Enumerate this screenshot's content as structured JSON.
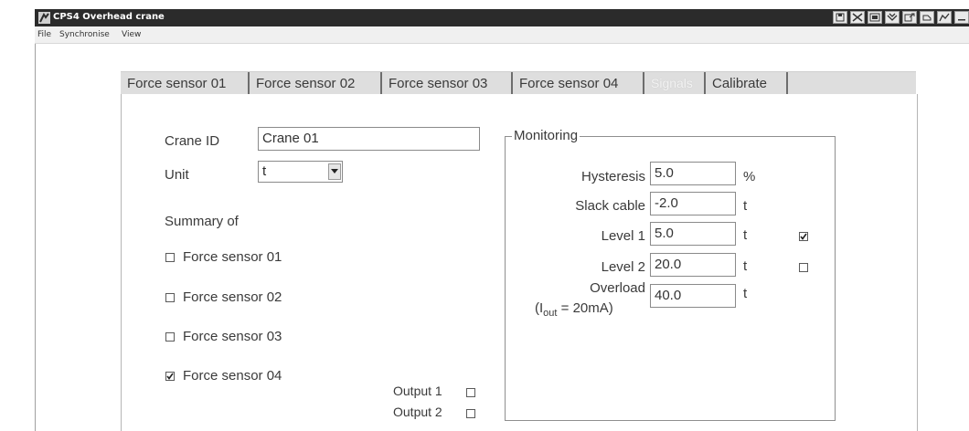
{
  "window": {
    "title": "CPS4 Overhead crane",
    "icons": [
      "app-icon",
      "save-icon",
      "tools-icon",
      "window-icon",
      "scale-icon",
      "export-icon",
      "refresh-icon",
      "graph-icon",
      "minimize-icon"
    ]
  },
  "menu": {
    "items": [
      "File",
      "Synchronise",
      "View"
    ]
  },
  "tabs": [
    {
      "label": "Force sensor 01",
      "enabled": true
    },
    {
      "label": "Force sensor 02",
      "enabled": true
    },
    {
      "label": "Force sensor 03",
      "enabled": true
    },
    {
      "label": "Force sensor 04",
      "enabled": true
    },
    {
      "label": "Signals",
      "enabled": false
    },
    {
      "label": "Calibrate",
      "enabled": true
    }
  ],
  "form": {
    "crane_id_label": "Crane ID",
    "crane_id_value": "Crane 01",
    "unit_label": "Unit",
    "unit_value": "t",
    "summary_label": "Summary of",
    "summary_sensors": [
      {
        "label": "Force sensor 01",
        "checked": false
      },
      {
        "label": "Force sensor 02",
        "checked": false
      },
      {
        "label": "Force sensor 03",
        "checked": false
      },
      {
        "label": "Force sensor 04",
        "checked": true
      }
    ],
    "outputs": [
      {
        "label": "Output 1",
        "checked": false
      },
      {
        "label": "Output 2",
        "checked": false
      }
    ]
  },
  "monitoring": {
    "legend": "Monitoring",
    "rows": [
      {
        "label": "Hysteresis",
        "value": "5.0",
        "unit": "%"
      },
      {
        "label": "Slack cable",
        "value": "-2.0",
        "unit": "t"
      },
      {
        "label": "Level 1",
        "value": "5.0",
        "unit": "t",
        "checked": true
      },
      {
        "label": "Level 2",
        "value": "20.0",
        "unit": "t",
        "checked": false
      },
      {
        "label": "Overload",
        "value": "40.0",
        "unit": "t"
      }
    ],
    "overload_note_prefix": "(I",
    "overload_note_sub": "out",
    "overload_note_suffix": " = 20mA)"
  },
  "colors": {
    "titlebar": "#2b2b2b",
    "tabstrip": "#dedede",
    "text": "#3a3a3a"
  }
}
